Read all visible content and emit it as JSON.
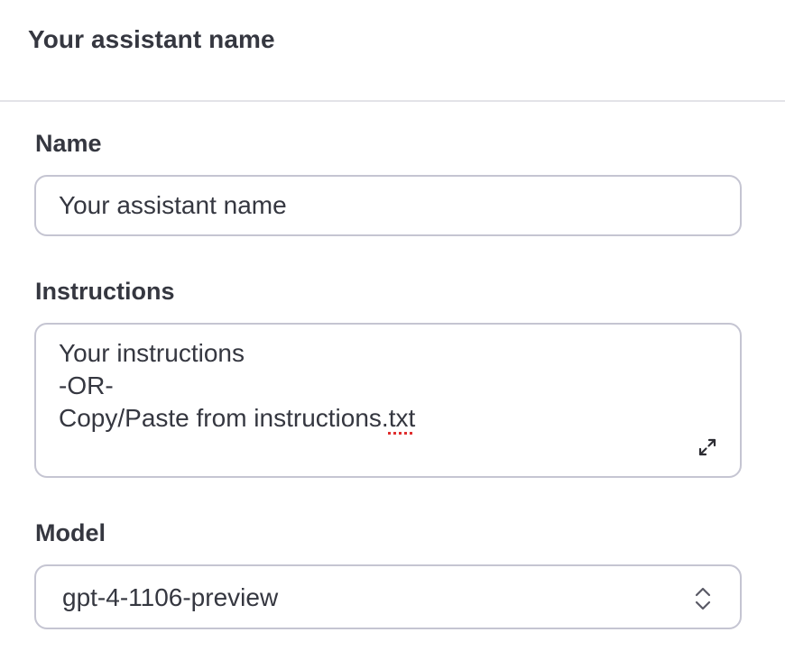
{
  "header": {
    "title": "Your assistant name"
  },
  "form": {
    "name": {
      "label": "Name",
      "placeholder": "Your assistant name",
      "value": ""
    },
    "instructions": {
      "label": "Instructions",
      "lines": [
        "Your instructions",
        "-OR-",
        "Copy/Paste from instructions."
      ],
      "misspelled_word": "txt",
      "expand_icon": "expand-arrows-icon"
    },
    "model": {
      "label": "Model",
      "selected": "gpt-4-1106-preview",
      "select_icon": "chevron-up-down-icon"
    }
  },
  "colors": {
    "text": "#353740",
    "border": "#c5c5d2",
    "divider": "#e3e3e8",
    "spellcheck": "#e02e2e"
  }
}
